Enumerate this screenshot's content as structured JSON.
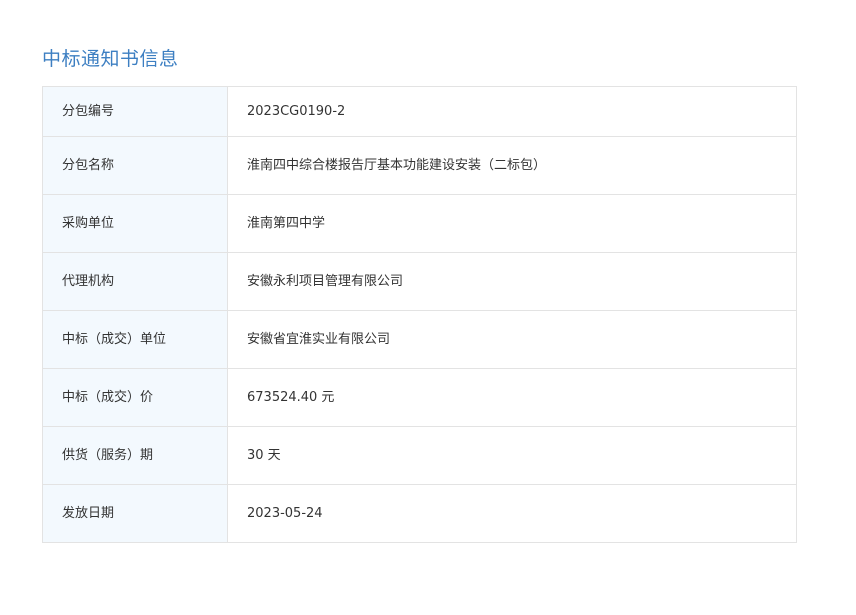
{
  "section_title": "中标通知书信息",
  "rows": [
    {
      "label": "分包编号",
      "value": "2023CG0190-2"
    },
    {
      "label": "分包名称",
      "value": "淮南四中综合楼报告厅基本功能建设安装（二标包）"
    },
    {
      "label": "采购单位",
      "value": "淮南第四中学"
    },
    {
      "label": "代理机构",
      "value": "安徽永利项目管理有限公司"
    },
    {
      "label": "中标（成交）单位",
      "value": "安徽省宜淮实业有限公司"
    },
    {
      "label": "中标（成交）价",
      "value": "673524.40 元"
    },
    {
      "label": "供货（服务）期",
      "value": "30 天"
    },
    {
      "label": "发放日期",
      "value": "2023-05-24"
    }
  ],
  "colors": {
    "title": "#3d7fc2",
    "label_bg": "#f3f9fe",
    "border": "#e3e3e3",
    "text": "#333333"
  }
}
